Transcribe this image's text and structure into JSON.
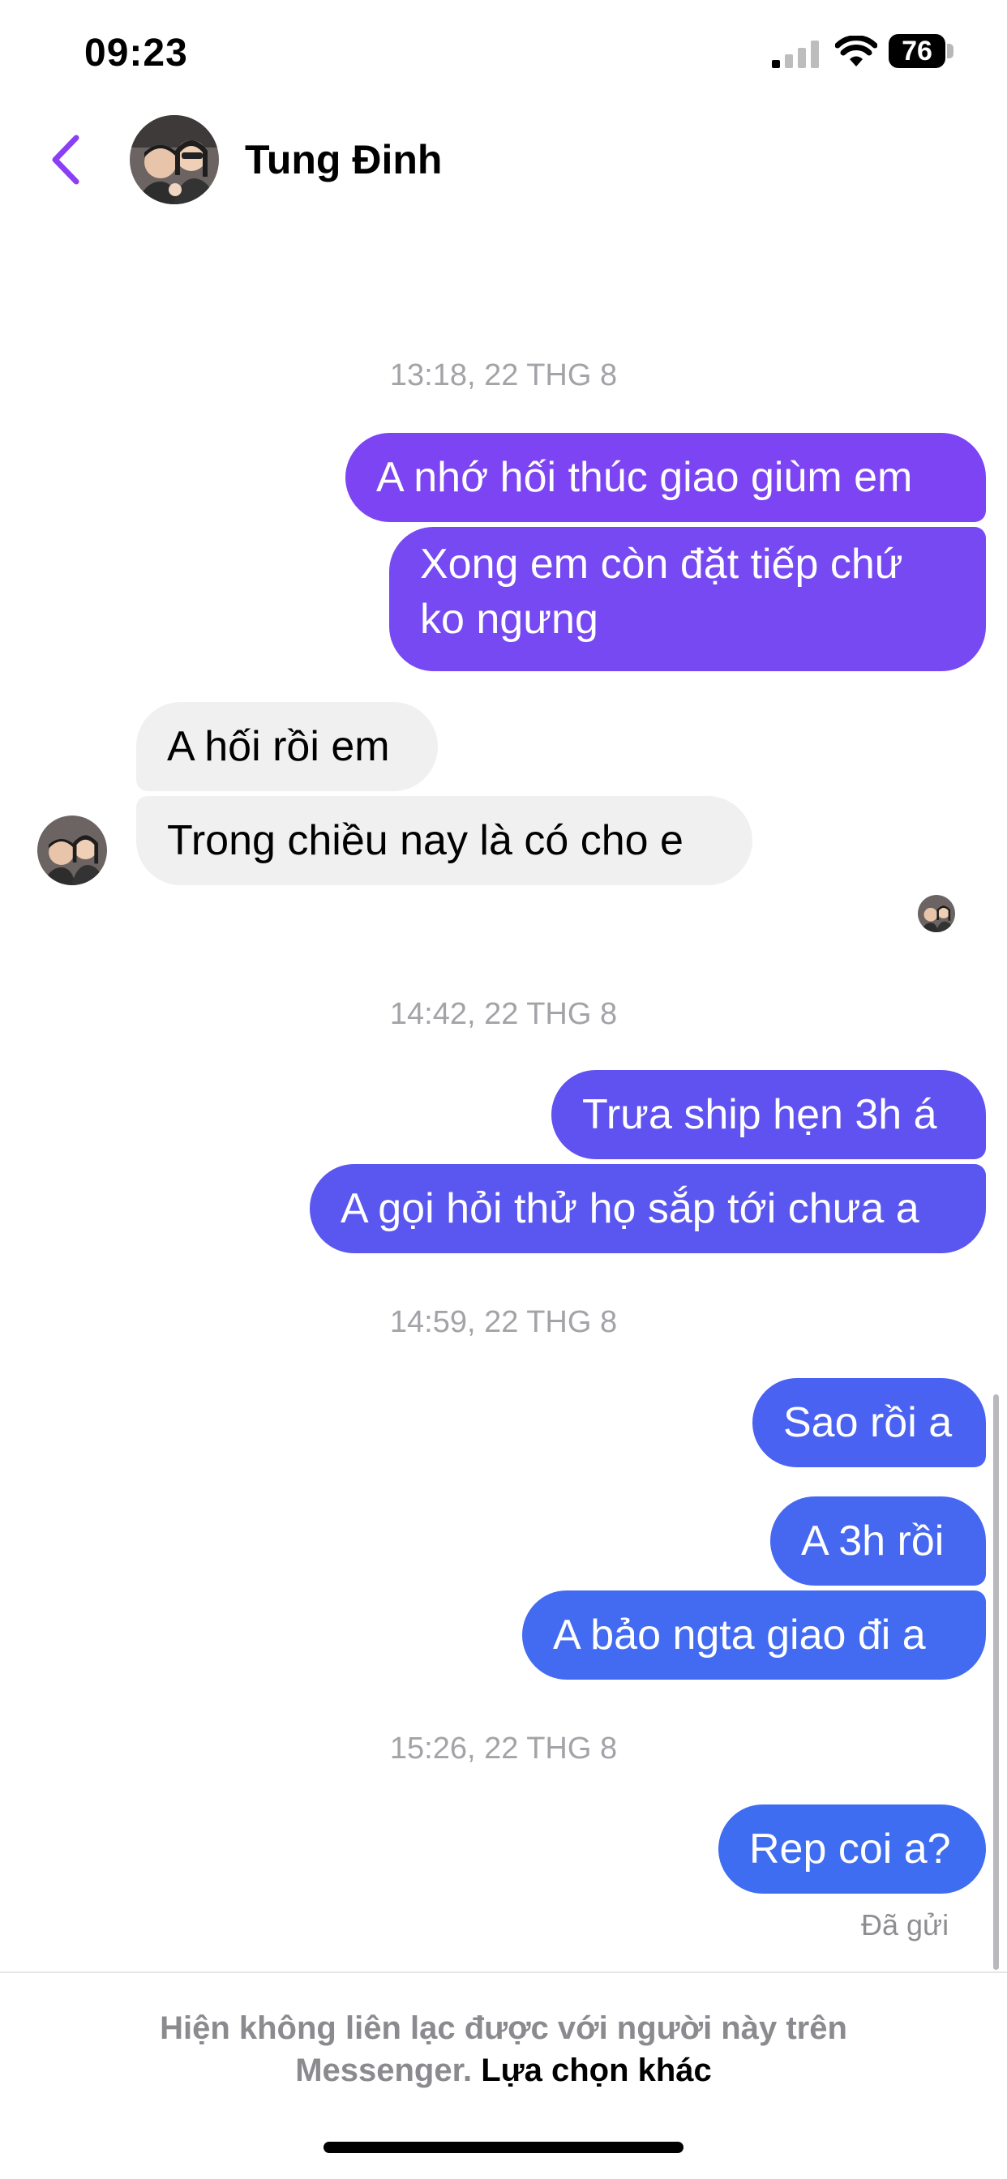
{
  "status_bar": {
    "time": "09:23",
    "battery": "76"
  },
  "header": {
    "contact_name": "Tung Đinh"
  },
  "timestamps": [
    "13:18, 22 THG 8",
    "14:42, 22 THG 8",
    "14:59, 22 THG 8",
    "15:26, 22 THG 8"
  ],
  "messages": [
    {
      "text": "A nhớ hối thúc giao giùm em"
    },
    {
      "text": "Xong em còn đặt tiếp chứ ko ngưng"
    },
    {
      "text": "A hối rồi em"
    },
    {
      "text": "Trong chiều nay là có cho e"
    },
    {
      "text": "Trưa ship hẹn 3h á"
    },
    {
      "text": "A gọi hỏi thử họ sắp tới chưa a"
    },
    {
      "text": "Sao rồi a"
    },
    {
      "text": "A 3h rồi"
    },
    {
      "text": "A bảo ngta giao đi a"
    },
    {
      "text": "Rep coi a?"
    }
  ],
  "message_status": "Đã gửi",
  "footer": {
    "notice": "Hiện không liên lạc được với người này trên Messenger.",
    "link": "Lựa chọn khác"
  },
  "colors": {
    "accent_purple": "#8a3ff5",
    "outgoing_purple": "#7b46f2",
    "outgoing_indigo": "#5a55f0",
    "outgoing_blue": "#3f6df2",
    "incoming_gray": "#f0f0f0"
  }
}
